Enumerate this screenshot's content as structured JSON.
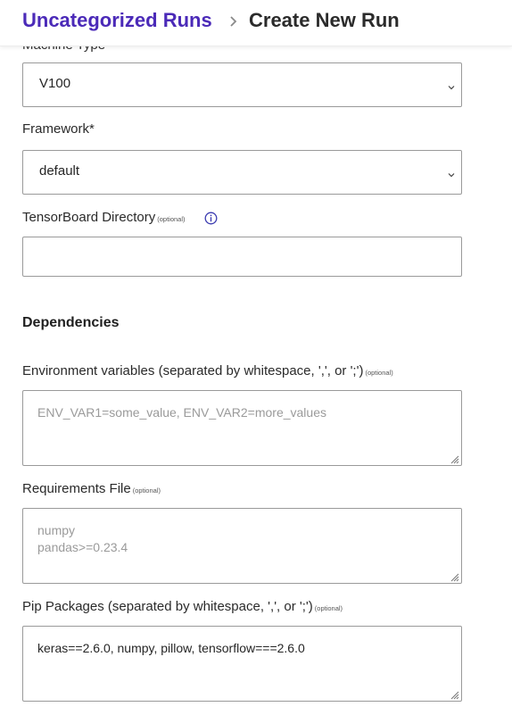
{
  "breadcrumb": {
    "parent": "Uncategorized Runs",
    "current": "Create New Run"
  },
  "peek_label": "Machine Type*",
  "machine_type": {
    "value": "V100"
  },
  "framework": {
    "label": "Framework*",
    "value": "default"
  },
  "tensorboard": {
    "label": "TensorBoard Directory",
    "optional": "(optional)",
    "value": ""
  },
  "dependencies": {
    "title": "Dependencies",
    "env_vars": {
      "label": "Environment variables (separated by whitespace, ',', or ';')",
      "optional": "(optional)",
      "placeholder": "ENV_VAR1=some_value, ENV_VAR2=more_values"
    },
    "requirements": {
      "label": "Requirements File",
      "optional": "(optional)",
      "placeholder": "numpy\npandas>=0.23.4"
    },
    "pip": {
      "label": "Pip Packages (separated by whitespace, ',', or ';')",
      "optional": "(optional)",
      "value": "keras==2.6.0, numpy, pillow, tensorflow===2.6.0"
    }
  },
  "colors": {
    "accent": "#4b2ab8",
    "border": "#9a9a9a",
    "info": "#3b3bb0"
  },
  "icons": [
    "chevron-right-icon",
    "chevron-down-icon",
    "info-icon",
    "resize-grip-icon"
  ]
}
